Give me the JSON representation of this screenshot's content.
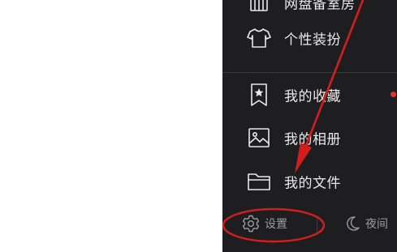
{
  "menu": {
    "items": [
      {
        "label": "网盘备室房",
        "icon": "building-icon"
      },
      {
        "label": "个性装扮",
        "icon": "tshirt-icon"
      },
      {
        "label": "我的收藏",
        "icon": "bookmark-star-icon",
        "has_dot": true
      },
      {
        "label": "我的相册",
        "icon": "image-icon"
      },
      {
        "label": "我的文件",
        "icon": "folder-icon"
      }
    ]
  },
  "bottom": {
    "settings_label": "设置",
    "night_label": "夜间"
  },
  "colors": {
    "panel_bg": "#1e1e20",
    "text": "#e9e9ea",
    "muted_text": "#9c9ca0",
    "annotation_red": "#d21e1e",
    "badge": "#e0352b"
  }
}
